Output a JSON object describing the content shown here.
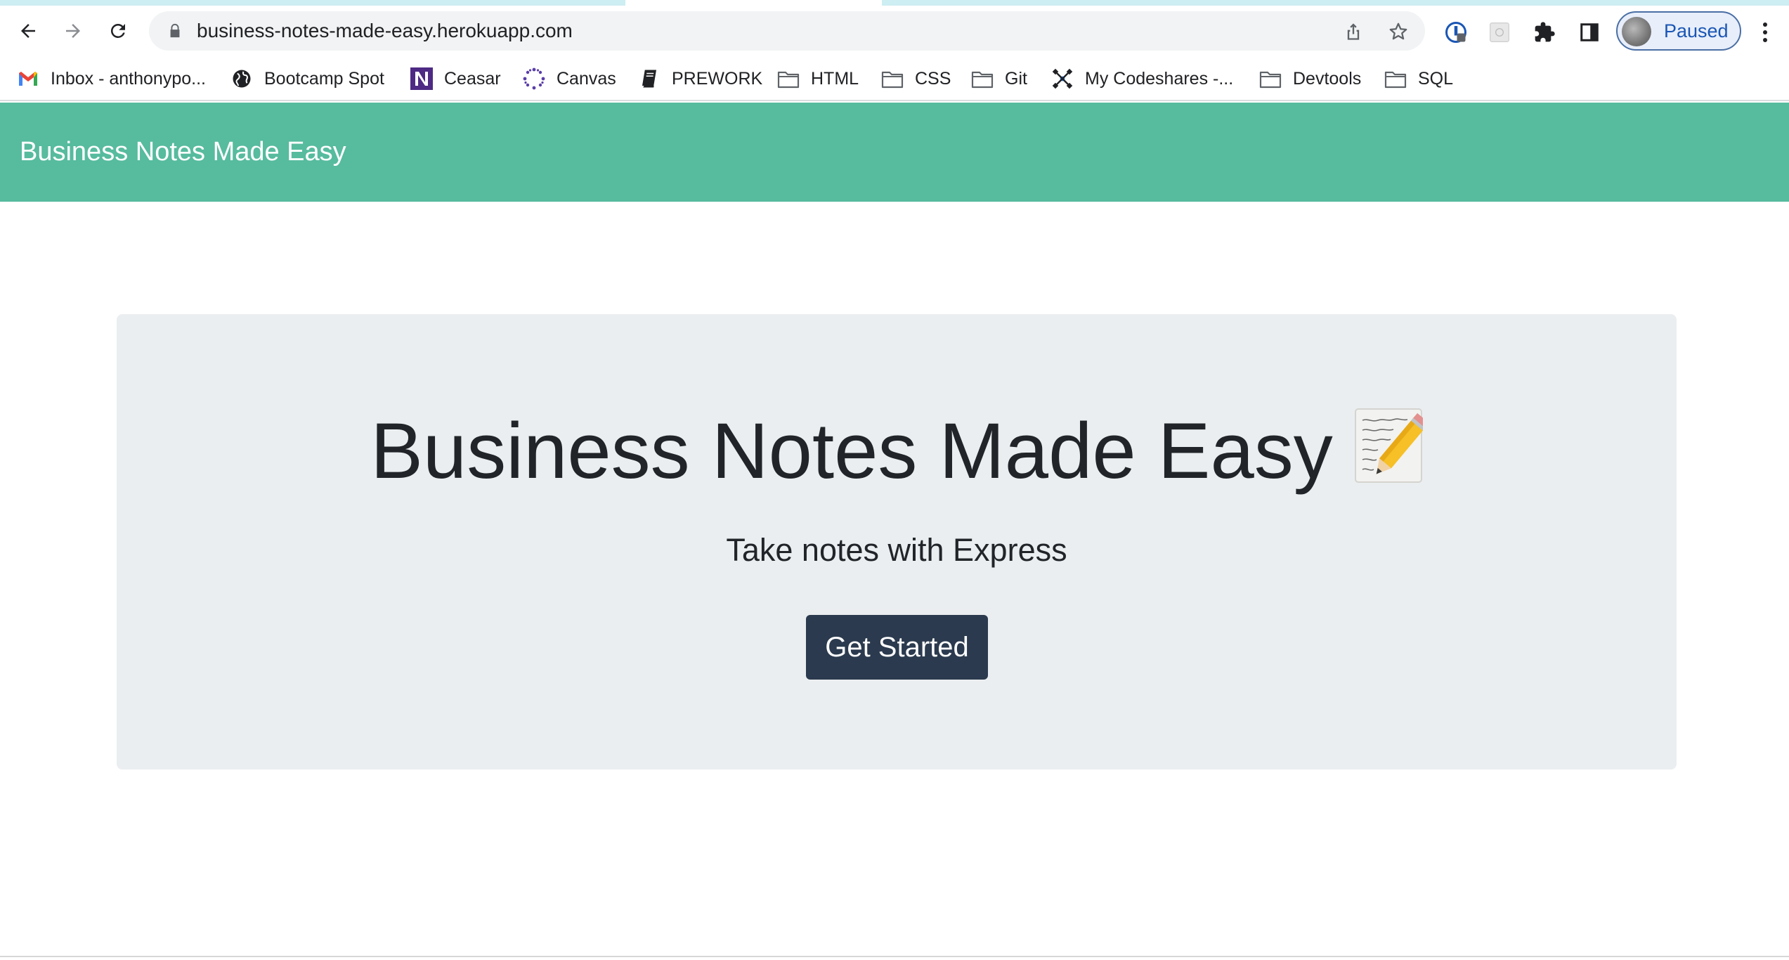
{
  "browser": {
    "url": "business-notes-made-easy.herokuapp.com",
    "profile_status": "Paused",
    "icons": {
      "back": "arrow-left-icon",
      "forward": "arrow-right-icon",
      "reload": "reload-icon",
      "lock": "lock-icon",
      "share": "share-icon",
      "bookmark_star": "star-icon",
      "extension_1": "password-manager-icon",
      "extension_2": "extension-grid-icon",
      "extensions": "puzzle-icon",
      "side_panel": "side-panel-icon",
      "menu": "kebab-menu-icon"
    },
    "bookmarks": [
      {
        "label": "Inbox - anthonypo...",
        "icon": "gmail-icon"
      },
      {
        "label": "Bootcamp Spot",
        "icon": "globe-icon"
      },
      {
        "label": "Ceasar",
        "icon": "northwestern-icon"
      },
      {
        "label": "Canvas",
        "icon": "canvas-icon"
      },
      {
        "label": "PREWORK",
        "icon": "book-icon"
      },
      {
        "label": "HTML",
        "icon": "folder-icon"
      },
      {
        "label": "CSS",
        "icon": "folder-icon"
      },
      {
        "label": "Git",
        "icon": "folder-icon"
      },
      {
        "label": "My Codeshares -...",
        "icon": "codeshare-icon"
      },
      {
        "label": "Devtools",
        "icon": "folder-icon"
      },
      {
        "label": "SQL",
        "icon": "folder-icon"
      }
    ]
  },
  "page": {
    "navbar": {
      "brand": "Business Notes Made Easy"
    },
    "hero": {
      "title": "Business Notes Made Easy",
      "title_emoji": "memo-icon",
      "subtitle": "Take notes with Express",
      "cta_label": "Get Started"
    }
  },
  "colors": {
    "navbar": "#57bb9e",
    "jumbotron": "#ebeef0",
    "cta_button": "#2b3a4e",
    "text": "#212529"
  }
}
